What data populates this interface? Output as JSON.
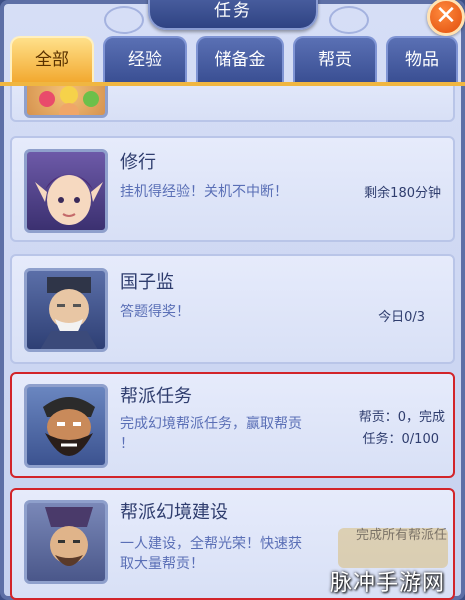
{
  "window": {
    "title": "任务",
    "close_label": "✕"
  },
  "tabs": [
    {
      "label": "全部",
      "active": true
    },
    {
      "label": "经验",
      "active": false
    },
    {
      "label": "储备金",
      "active": false
    },
    {
      "label": "帮贡",
      "active": false
    },
    {
      "label": "物品",
      "active": false
    }
  ],
  "tasks": [
    {
      "name": "修行",
      "desc_lines": [
        "挂机得经验！关机不中断！"
      ],
      "status_lines": [
        "剩余180分钟"
      ],
      "portrait": "xiuxing-portrait",
      "highlighted": false
    },
    {
      "name": "国子监",
      "desc_lines": [
        "答题得奖！"
      ],
      "status_lines": [
        "今日0/3"
      ],
      "portrait": "guozijian-portrait",
      "highlighted": false
    },
    {
      "name": "帮派任务",
      "desc_lines": [
        "完成幻境帮派任务，赢取帮贡",
        "！"
      ],
      "status_lines": [
        "帮贡：0，完成",
        "任务：0/100"
      ],
      "portrait": "bangpai-portrait",
      "highlighted": true
    },
    {
      "name": "帮派幻境建设",
      "desc_lines": [
        "一人建设，全帮光荣！快速获",
        "取大量帮贡！"
      ],
      "status_lines": [
        "完成所有帮派任"
      ],
      "portrait": "huanjing-portrait",
      "highlighted": true
    }
  ],
  "watermark": "脉冲手游网",
  "colors": {
    "active_tab": "#f2a930",
    "highlight_border": "#d2242a",
    "desc_text": "#5a6fb6"
  }
}
